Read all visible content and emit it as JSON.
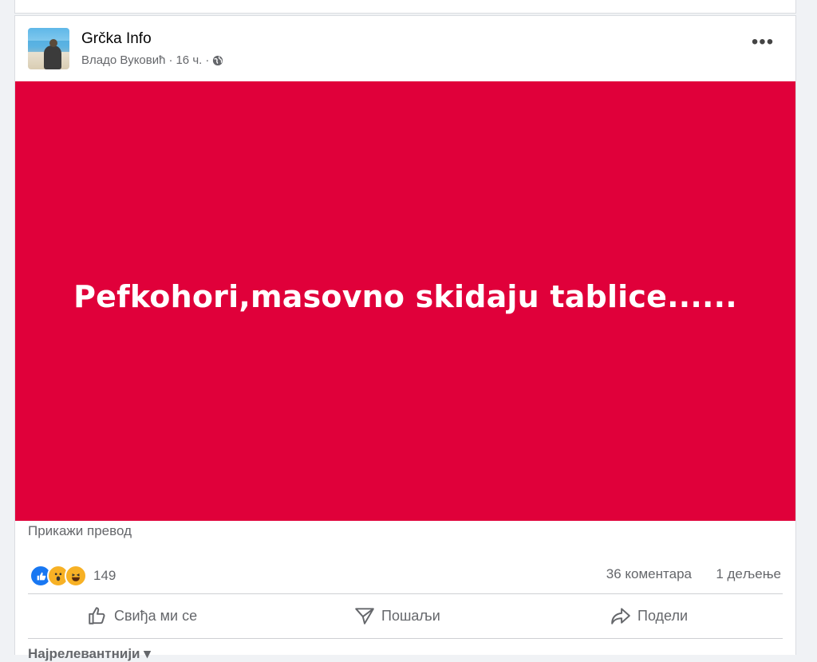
{
  "post": {
    "page_name": "Grčka Info",
    "author": "Владо Вуковић",
    "separator": "·",
    "time": "16 ч.",
    "separator2": "·",
    "more_label": "•••",
    "image_text": "Pefkohori,masovno skidaju tablice......",
    "image_bg": "#e0003a",
    "translate_label": "Прикажи превод",
    "reaction_count": "149",
    "comments": "36 коментара",
    "shares": "1 дељење",
    "actions": {
      "like": "Свиђа ми се",
      "send": "Пошаљи",
      "share": "Подели"
    },
    "sort_label": "Најрелевантнији"
  }
}
